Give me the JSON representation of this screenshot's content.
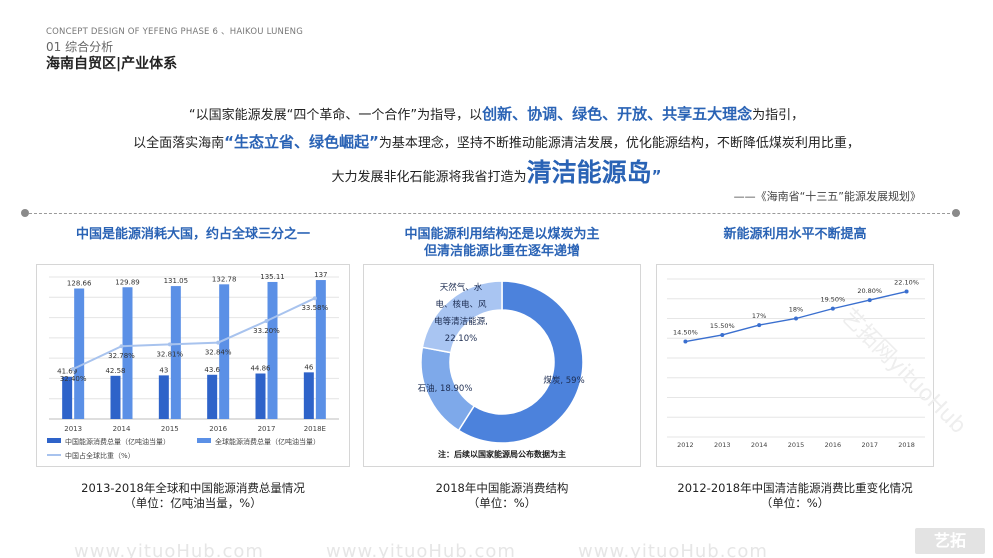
{
  "header": {
    "english": "CONCEPT DESIGN OF YEFENG PHASE 6 、HAIKOU LUNENG",
    "section": "01 综合分析",
    "title": "海南自贸区|产业体系"
  },
  "intro": {
    "line1_a": "“以国家能源发展“四个革命、一个合作”为指导，以",
    "line1_b": "创新、协调、绿色、开放、共享五大理念",
    "line1_c": "为指引，",
    "line2_a": "以全面落实海南",
    "line2_b": "“生态立省、绿色崛起”",
    "line2_c": "为基本理念，坚持不断推动能源清洁发展，优化能源结构，不断降低煤炭利用比重，",
    "line3_a": "大力发展非化石能源将我省打造为",
    "line3_b": "清洁能源岛",
    "line3_c": "”",
    "source": "——《海南省“十三五”能源发展规划》"
  },
  "panels": [
    {
      "title": "中国是能源消耗大国，约占全球三分之一",
      "caption_1": "2013-2018年全球和中国能源消费总量情况",
      "caption_2": "（单位：亿吨油当量，%）"
    },
    {
      "title_1": "中国能源利用结构还是以煤炭为主",
      "title_2": "但清洁能源比重在逐年递增",
      "caption_1": "2018年中国能源消费结构",
      "caption_2": "（单位：%）",
      "note": "注：后续以国家能源局公布数据为主"
    },
    {
      "title": "新能源利用水平不断提高",
      "caption_1": "2012-2018年中国清洁能源消费比重变化情况",
      "caption_2": "（单位：%）"
    }
  ],
  "watermark": {
    "bottom_text": "www.yituoHub.com",
    "side_text": "艺拓网yituoHub",
    "logo_text": "艺拓"
  },
  "colors": {
    "accent": "#2a63b5",
    "bar_china": "#2e63c9",
    "bar_global": "#5b90e6",
    "line": "#a8c3ee",
    "donut_coal": "#4c82dc",
    "donut_oil": "#7ea9ea",
    "donut_clean": "#a9c5f2",
    "dot_line": "#3a6fcf"
  },
  "chart_data": [
    {
      "type": "bar",
      "categories": [
        "2013",
        "2014",
        "2015",
        "2016",
        "2017",
        "2018E"
      ],
      "series": [
        {
          "name": "中国能源消费总量（亿吨油当量）",
          "values": [
            41.69,
            42.58,
            43,
            43.6,
            44.86,
            46
          ],
          "labels": [
            "41.69",
            "42.58",
            "43",
            "43.6",
            "44.86",
            "46"
          ]
        },
        {
          "name": "全球能源消费总量（亿吨油当量）",
          "values": [
            128.66,
            129.89,
            131.05,
            132.78,
            135.11,
            137
          ],
          "labels": [
            "128.66",
            "129.89",
            "131.05",
            "132.78",
            "135.11",
            "137"
          ]
        },
        {
          "name": "中国占全球比重（%）",
          "values": [
            32.4,
            32.78,
            32.81,
            32.84,
            33.2,
            33.58
          ],
          "labels": [
            "32.40%",
            "32.78%",
            "32.81%",
            "32.84%",
            "33.20%",
            "33.58%"
          ]
        }
      ],
      "ylim": [
        0,
        140
      ],
      "ratio_ylim": [
        32.0,
        33.8
      ],
      "grid": "horizontal",
      "legend": "bottom"
    },
    {
      "type": "pie",
      "donut": true,
      "slices": [
        {
          "label": "煤炭, 59%",
          "value": 59.0
        },
        {
          "label": "石油, 18.90%",
          "value": 18.9
        },
        {
          "label_lines": [
            "天然气、水",
            "电、核电、风",
            "电等清洁能源,",
            "22.10%"
          ],
          "value": 22.1
        }
      ]
    },
    {
      "type": "line",
      "categories": [
        "2012",
        "2013",
        "2014",
        "2015",
        "2016",
        "2017",
        "2018"
      ],
      "values": [
        14.5,
        15.5,
        17,
        18,
        19.5,
        20.8,
        22.1
      ],
      "labels": [
        "14.50%",
        "15.50%",
        "17%",
        "18%",
        "19.50%",
        "20.80%",
        "22.10%"
      ],
      "ylim": [
        0,
        24
      ],
      "grid": "horizontal"
    }
  ]
}
